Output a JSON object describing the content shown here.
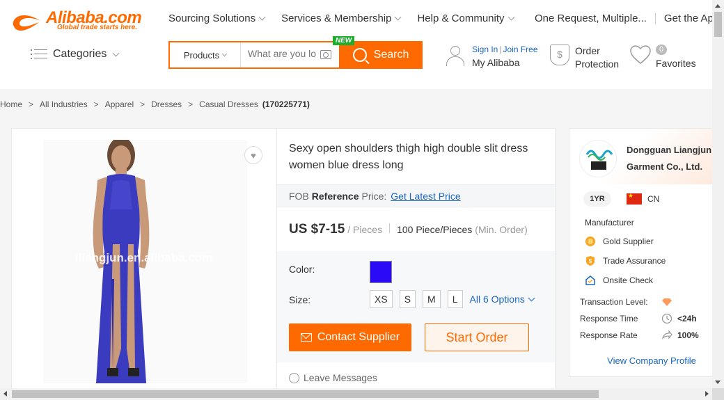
{
  "header": {
    "logo_text": "Alibaba.com",
    "logo_tagline": "Global trade starts here.",
    "nav": [
      "Sourcing Solutions",
      "Services & Membership",
      "Help & Community"
    ],
    "one_request": "One Request, Multiple...",
    "get_app": "Get the App",
    "categories_label": "Categories",
    "search": {
      "category": "Products",
      "placeholder": "What are you lo",
      "button_label": "Search",
      "new_badge": "NEW"
    },
    "user": {
      "sign_in": "Sign In",
      "join_free": "Join Free",
      "my_alibaba": "My Alibaba"
    },
    "order_protection": [
      "Order",
      "Protection"
    ],
    "favorites": {
      "count": "0",
      "label": "Favorites"
    }
  },
  "breadcrumb": {
    "items": [
      "Home",
      "All Industries",
      "Apparel",
      "Dresses",
      "Casual Dresses"
    ],
    "product_id": "(170225771)"
  },
  "product": {
    "watermark": "iliangjun.en.alibaba.com",
    "title": "Sexy open shoulders thigh high double slit dress women blue dress long",
    "fob_prefix": "FOB",
    "fob_reference": "Reference",
    "fob_price": "Price:",
    "latest_price_link": "Get Latest Price",
    "price": "US $7-15",
    "price_unit": "/ Pieces",
    "moq": "100 Piece/Pieces",
    "moq_note": "(Min. Order)",
    "color_label": "Color:",
    "color_value": "#2b0af5",
    "size_label": "Size:",
    "sizes": [
      "XS",
      "S",
      "M",
      "L"
    ],
    "all_options": "All 6 Options",
    "contact_button": "Contact Supplier",
    "order_button": "Start Order",
    "leave_messages": "Leave Messages"
  },
  "supplier": {
    "name_line1": "Dongguan Liangjun",
    "name_line2": "Garment Co., Ltd.",
    "years": "1YR",
    "country": "CN",
    "type": "Manufacturer",
    "features": [
      "Gold Supplier",
      "Trade Assurance",
      "Onsite Check"
    ],
    "metrics": [
      {
        "label": "Transaction Level:",
        "value": ""
      },
      {
        "label": "Response Time",
        "value": "<24h"
      },
      {
        "label": "Response Rate",
        "value": "100%"
      }
    ],
    "view_profile": "View Company Profile"
  },
  "colors": {
    "accent": "#ff6a00",
    "link": "#1a66c2",
    "new_badge": "#1cae2d"
  }
}
